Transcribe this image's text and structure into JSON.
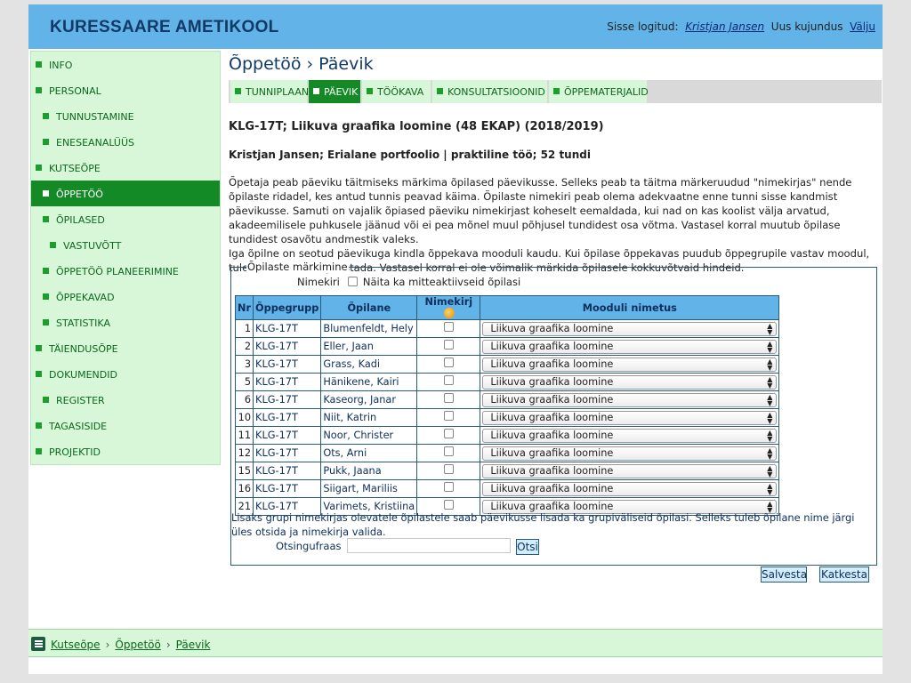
{
  "header": {
    "brand": "KURESSAARE AMETIKOOL",
    "logged_in_label": "Sisse logitud:",
    "user": "Kristjan Jansen",
    "theme_link_prefix": "Uus kujundus",
    "logout": "Välju"
  },
  "sidebar": {
    "items": [
      {
        "label": "INFO",
        "level": 0,
        "active": false
      },
      {
        "label": "PERSONAL",
        "level": 0,
        "active": false
      },
      {
        "label": "TUNNUSTAMINE",
        "level": 1,
        "active": false
      },
      {
        "label": "ENESEANALÜÜS",
        "level": 1,
        "active": false
      },
      {
        "label": "KUTSEÕPE",
        "level": 0,
        "active": false
      },
      {
        "label": "ÕPPETÖÖ",
        "level": 1,
        "active": true
      },
      {
        "label": "ÕPILASED",
        "level": 1,
        "active": false
      },
      {
        "label": "VASTUVÕTT",
        "level": 2,
        "active": false
      },
      {
        "label": "ÕPPETÖÖ PLANEERIMINE",
        "level": 1,
        "active": false
      },
      {
        "label": "ÕPPEKAVAD",
        "level": 1,
        "active": false
      },
      {
        "label": "STATISTIKA",
        "level": 1,
        "active": false
      },
      {
        "label": "TÄIENDUSÕPE",
        "level": 0,
        "active": false
      },
      {
        "label": "DOKUMENDID",
        "level": 0,
        "active": false
      },
      {
        "label": "REGISTER",
        "level": 1,
        "active": false
      },
      {
        "label": "TAGASISIDE",
        "level": 0,
        "active": false
      },
      {
        "label": "PROJEKTID",
        "level": 0,
        "active": false
      }
    ]
  },
  "main": {
    "title": "Õppetöö › Päevik",
    "tabs": [
      "TUNNIPLAAN",
      "PÄEVIK",
      "TÖÖKAVA",
      "KONSULTATSIOONID",
      "ÕPPEMATERJALID"
    ],
    "active_tab": "PÄEVIK",
    "heading": "KLG-17T; Liikuva graafika loomine (48 EKAP) (2018/2019)",
    "subheading": "Kristjan Jansen; Erialane portfoolio | praktiline töö; 52 tundi",
    "desc1": "Õpetaja peab päeviku täitmiseks märkima õpilased päevikusse. Selleks peab ta täitma märkeruudud \"nimekirjas\" nende õpilaste ridadel, kes antud tunnis peavad käima. Õpilaste nimekiri peab olema adekvaatne enne tunni sisse kandmist päevikusse. Samuti on vajalik õpiased päeviku nimekirjast koheselt eemaldada, kui nad on kas koolist välja arvatud, akadeemilisele puhkusele jäänud või ei pea mõnel muul põhjusel tundidest osa võtma. Vastasel korral muutub õpilase tundidest osavõtu andmestik valeks.",
    "desc2": "Iga õpilne on seotud päevikuga kindla õppekava mooduli kaudu. Kui õpilase õppekavas puudub õppegrupile vastav moodul, tuleb see käsitsi täpsustada. Vastasel korral ei ole võimalik märkida õpilasele kokkuvõtvaid hindeid."
  },
  "students": {
    "legend": "Õpilaste märkimine",
    "filter_label": "Nimekiri",
    "filter_option": "Näita ka mitteaktiivseid õpilasi",
    "columns": [
      "Nr",
      "Õppegrupp",
      "Õpilane",
      "Nimekirj",
      "Mooduli nimetus"
    ],
    "rows": [
      {
        "nr": "1",
        "group": "KLG-17T",
        "name": "Blumenfeldt, Hely",
        "module": "Liikuva graafika loomine"
      },
      {
        "nr": "2",
        "group": "KLG-17T",
        "name": "Eller, Jaan",
        "module": "Liikuva graafika loomine"
      },
      {
        "nr": "3",
        "group": "KLG-17T",
        "name": "Grass, Kadi",
        "module": "Liikuva graafika loomine"
      },
      {
        "nr": "5",
        "group": "KLG-17T",
        "name": "Hänikene, Kairi",
        "module": "Liikuva graafika loomine"
      },
      {
        "nr": "6",
        "group": "KLG-17T",
        "name": "Kaseorg, Janar",
        "module": "Liikuva graafika loomine"
      },
      {
        "nr": "10",
        "group": "KLG-17T",
        "name": "Niit, Katrin",
        "module": "Liikuva graafika loomine"
      },
      {
        "nr": "11",
        "group": "KLG-17T",
        "name": "Noor, Christer",
        "module": "Liikuva graafika loomine"
      },
      {
        "nr": "12",
        "group": "KLG-17T",
        "name": "Ots, Arni",
        "module": "Liikuva graafika loomine"
      },
      {
        "nr": "15",
        "group": "KLG-17T",
        "name": "Pukk, Jaana",
        "module": "Liikuva graafika loomine"
      },
      {
        "nr": "16",
        "group": "KLG-17T",
        "name": "Siigart, Mariliis",
        "module": "Liikuva graafika loomine"
      },
      {
        "nr": "21",
        "group": "KLG-17T",
        "name": "Varimets, Kristiina",
        "module": "Liikuva graafika loomine"
      }
    ],
    "note": "Lisaks grupi nimekirjas olevatele õpilastele saab päevikusse lisada ka grupiväliseid õpilasi. Selleks tuleb õpilane nime järgi üles otsida ja nimekirja valida.",
    "search_label": "Otsingufraas",
    "search_value": "",
    "search_button": "Otsi"
  },
  "actions": {
    "save": "Salvesta",
    "cancel": "Katkesta"
  },
  "breadcrumb": [
    "Kutseõpe",
    "Õppetöö",
    "Päevik"
  ],
  "colors": {
    "header_bg": "#62b4e8",
    "nav_bg": "#d8f6d8",
    "nav_active": "#138a26"
  }
}
